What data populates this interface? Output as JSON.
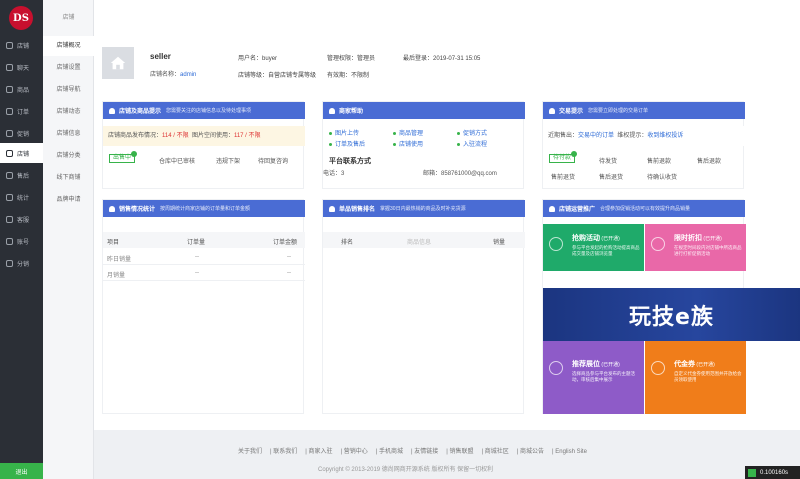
{
  "app": {
    "logo": "DS",
    "logout": "退出"
  },
  "nav": {
    "items": [
      "店铺",
      "聊天",
      "商品",
      "订单",
      "促销",
      "店铺",
      "售后",
      "统计",
      "客服",
      "账号",
      "分销"
    ]
  },
  "subnav": {
    "title": "店铺",
    "items": [
      "店铺概况",
      "店铺设置",
      "店铺导航",
      "店铺动态",
      "店铺信息",
      "店铺分类",
      "线下商铺",
      "品牌申请"
    ]
  },
  "profile": {
    "name": "seller",
    "code_label": "店铺名称：",
    "code_value": "admin",
    "user_label": "用户名：",
    "user_value": "buyer",
    "level_label": "店铺等级：",
    "level_value": "自营店铺专属等级",
    "perm_label": "管理权限：",
    "perm_value": "管理员",
    "expire_label": "有效期：",
    "expire_value": "不限制",
    "last_login_label": "最后登录：",
    "last_login_value": "2019-07-31 15:05"
  },
  "panel1": {
    "title": "店铺及商品提示",
    "desc": "您需要关注的店铺信息以及待处理事项",
    "tip_a": "店铺商品发布情况：",
    "tip_a_val": "114 / 不限",
    "tip_b": "图片空间使用：",
    "tip_b_val": "117 / 不限",
    "badge": "出售中",
    "cells": [
      "仓库中已审核",
      "违规下架",
      "待回复咨询"
    ]
  },
  "panel2": {
    "title": "商家帮助",
    "links": [
      "图片上传",
      "商品管理",
      "促销方式",
      "订单及售后",
      "店铺使用",
      "入驻流程"
    ],
    "contact_title": "平台联系方式",
    "phone_label": "电话：",
    "phone_value": "3",
    "email_label": "邮箱：",
    "email_value": "858761000@qq.com"
  },
  "panel3": {
    "title": "交易提示",
    "desc": "您需要立即处理的交易订单",
    "tip_a": "近期售出：",
    "tip_a_val": "交易中的订单",
    "tip_b": "维权提示：",
    "tip_b_val": "收到维权投诉",
    "badge": "待付款",
    "row1": [
      "待发货",
      "售前退款",
      "售后退款"
    ],
    "row2": [
      "售前退货",
      "售后退货",
      "待确认收货"
    ]
  },
  "panel4": {
    "title": "销售情况统计",
    "desc": "按周期统计商家店铺的订单量和订单金额",
    "headers": [
      "项目",
      "订单量",
      "订单金额"
    ],
    "rows": [
      [
        "昨日销量",
        "--",
        "--"
      ],
      [
        "月销量",
        "--",
        "--"
      ]
    ]
  },
  "panel5": {
    "title": "单品销售排名",
    "desc": "掌握30日内最热销的商品及时补充货源",
    "headers": [
      "排名",
      "商品信息",
      "销量"
    ]
  },
  "panel6": {
    "title": "店铺运营推广",
    "desc": "合理参加促销活动可以有效提升商品销量",
    "tiles": [
      {
        "title": "抢购活动",
        "tag": "已开通",
        "desc": "参与平台发起的抢购活动提高商品成交量及店铺浏览量",
        "color": "#1faa6a"
      },
      {
        "title": "限时折扣",
        "tag": "已开通",
        "desc": "在规定时间段内对店铺中所选商品进行打折促销活动",
        "color": "#e968a8"
      },
      {
        "title": "推荐展位",
        "tag": "已开通",
        "desc": "选择商品参与平台发布的主题活动，审核后集中展示",
        "color": "#8e5bc8"
      },
      {
        "title": "代金券",
        "tag": "已开通",
        "desc": "自定义代金券使用范围并开放给会员领取使用",
        "color": "#f07d1a"
      }
    ],
    "watermark": "玩技e族"
  },
  "footer": {
    "links": [
      "关于我们",
      "联系我们",
      "商家入驻",
      "营销中心",
      "手机商城",
      "友情链接",
      "销售联盟",
      "商城社区",
      "商城公告",
      "English Site"
    ],
    "copyright": "Copyright © 2013-2019 德尚网商开源系统 版权所有 保留一切权利"
  },
  "speed": "0.100160s"
}
